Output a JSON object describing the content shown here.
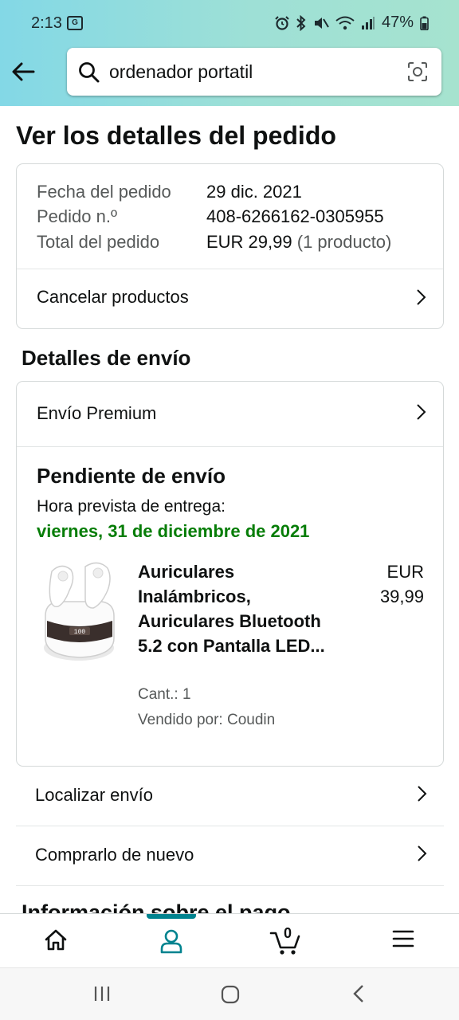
{
  "status_bar": {
    "time": "2:13",
    "battery": "47%"
  },
  "search": {
    "value": "ordenador portatil"
  },
  "page_title": "Ver los detalles del pedido",
  "order": {
    "date_label": "Fecha del pedido",
    "date_value": "29 dic. 2021",
    "number_label": "Pedido n.º",
    "number_value": "408-6266162-0305955",
    "total_label": "Total del pedido",
    "total_value": "EUR 29,99",
    "total_items": "(1 producto)",
    "cancel_label": "Cancelar productos"
  },
  "shipping": {
    "section_title": "Detalles de envío",
    "method": "Envío Premium",
    "status_title": "Pendiente de envío",
    "eta_label": "Hora prevista de entrega:",
    "eta_date": "viernes, 31 de diciembre de 2021",
    "product": {
      "name": "Auriculares Inalámbricos, Auriculares Bluetooth 5.2 con Pantalla LED...",
      "price": "EUR 39,99",
      "quantity": "Cant.: 1",
      "seller": "Vendido por: Coudin"
    },
    "track_label": "Localizar envío",
    "buy_again_label": "Comprarlo de nuevo"
  },
  "cut_section_title": "Información sobre el pago",
  "bottom_nav": {
    "items": [
      "home-icon",
      "account-icon",
      "cart-icon",
      "menu-icon"
    ],
    "active": "account-icon",
    "cart_count": "0"
  },
  "colors": {
    "accent": "#00838f",
    "eta_green": "#067d07",
    "header_gradient_start": "#83d8e6",
    "header_gradient_end": "#a6e3cf"
  }
}
